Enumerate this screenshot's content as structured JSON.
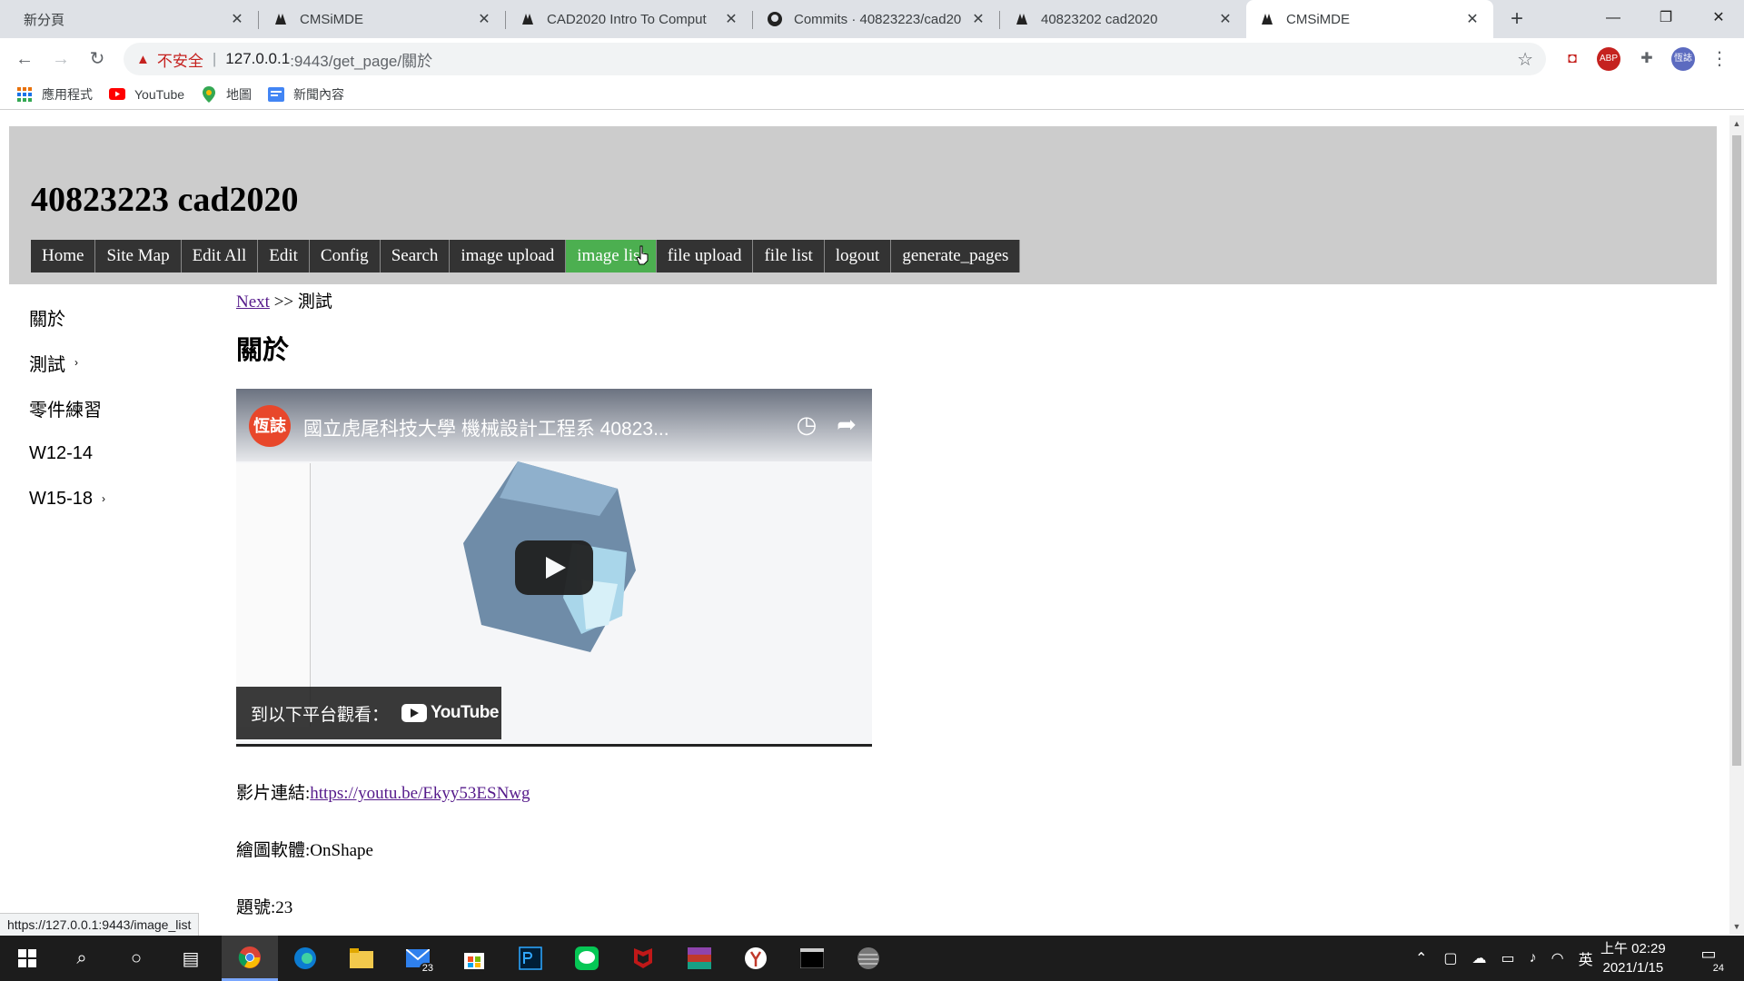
{
  "tabs": [
    {
      "title": "新分頁",
      "icon": "blank-icon"
    },
    {
      "title": "CMSiMDE",
      "icon": "cmsimde-icon"
    },
    {
      "title": "CAD2020 Intro To Comput",
      "icon": "cmsimde-icon"
    },
    {
      "title": "Commits · 40823223/cad20",
      "icon": "github-icon"
    },
    {
      "title": "40823202 cad2020",
      "icon": "cmsimde-icon"
    },
    {
      "title": "CMSiMDE",
      "icon": "cmsimde-icon"
    }
  ],
  "address": {
    "insecure_label": "不安全",
    "host": "127.0.0.1",
    "path": ":9443/get_page/關於"
  },
  "bookmarks": [
    {
      "label": "應用程式",
      "icon": "apps-grid-icon"
    },
    {
      "label": "YouTube",
      "icon": "youtube-icon"
    },
    {
      "label": "地圖",
      "icon": "maps-pin-icon"
    },
    {
      "label": "新聞內容",
      "icon": "news-icon"
    }
  ],
  "site": {
    "title": "40823223 cad2020",
    "menu": [
      "Home",
      "Site Map",
      "Edit All",
      "Edit",
      "Config",
      "Search",
      "image upload",
      "image list",
      "file upload",
      "file list",
      "logout",
      "generate_pages"
    ],
    "menu_active": "image list"
  },
  "sidebar": [
    {
      "label": "關於",
      "has_children": false
    },
    {
      "label": "測試",
      "has_children": true
    },
    {
      "label": "零件練習",
      "has_children": false
    },
    {
      "label": "W12-14",
      "has_children": false
    },
    {
      "label": "W15-18",
      "has_children": true
    }
  ],
  "content": {
    "breadcrumb_next": "Next",
    "breadcrumb_sep": ">>",
    "breadcrumb_current": "測試",
    "heading": "關於",
    "video": {
      "channel_avatar": "恆誌",
      "title": "國立虎尾科技大學 機械設計工程系 40823...",
      "watch_on": "到以下平台觀看：",
      "youtube_label": "YouTube"
    },
    "link_label": "影片連結:",
    "link_url": "https://youtu.be/Ekyy53ESNwg",
    "software_label": "繪圖軟體:OnShape",
    "question_label": "題號:23"
  },
  "status_url": "https://127.0.0.1:9443/image_list",
  "taskbar": {
    "mail_badge": "23",
    "ime": "英",
    "time": "上午 02:29",
    "date": "2021/1/15",
    "notifications": "24"
  },
  "colors": {
    "header_bg": "#cccccc",
    "menu_bg": "#333333",
    "menu_active": "#4caf50",
    "link": "#551a8b"
  }
}
